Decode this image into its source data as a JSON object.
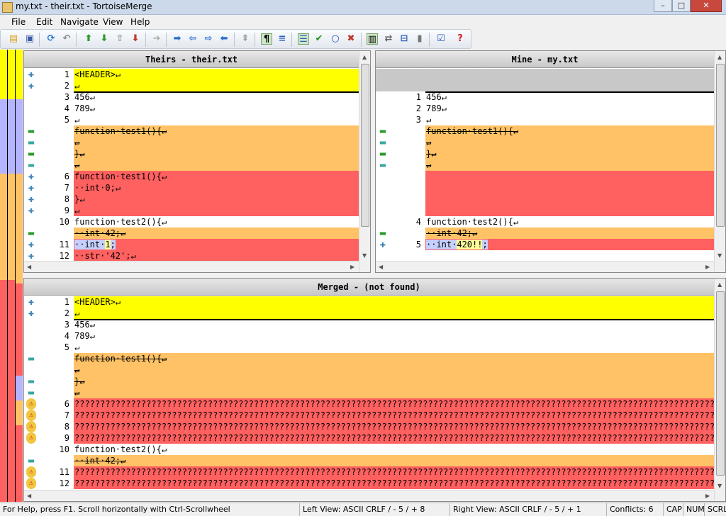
{
  "window": {
    "title": "my.txt - their.txt - TortoiseMerge",
    "min": "–",
    "max": "□",
    "close": "✕"
  },
  "menu": {
    "file": "File",
    "edit": "Edit",
    "navigate": "Navigate",
    "view": "View",
    "help": "Help"
  },
  "toolbar": {
    "icons": [
      "open-icon",
      "save-icon",
      "reload-icon",
      "undo-icon",
      "next-diff-icon",
      "prev-diff-icon",
      "prev-conflict-icon",
      "next-conflict-icon",
      "next-inline-icon",
      "first-diff-icon",
      "back-icon",
      "forward-icon",
      "last-diff-icon",
      "wrap-icon",
      "whitespace-icon",
      "inline-diff-icon",
      "line-diff-icon",
      "mark-resolved-icon",
      "use-both-icon",
      "discard-icon",
      "one-pane-icon",
      "switch-icon",
      "collapse-icon",
      "scroll-icon",
      "patch-icon",
      "help-icon"
    ]
  },
  "theirs": {
    "header": "Theirs - their.txt",
    "rows": [
      {
        "icon": "+",
        "num": "1",
        "text": "<HEADER>↵",
        "kind": "added"
      },
      {
        "icon": "+",
        "num": "2",
        "text": "↵",
        "kind": "added"
      },
      {
        "icon": "",
        "num": "3",
        "text": "456↵",
        "kind": "normal"
      },
      {
        "icon": "",
        "num": "4",
        "text": "789↵",
        "kind": "normal"
      },
      {
        "icon": "",
        "num": "5",
        "text": "↵",
        "kind": "normal"
      },
      {
        "icon": "=",
        "num": "",
        "text": "function·test1(){↵",
        "kind": "removed"
      },
      {
        "icon": "-",
        "num": "",
        "text": "↵",
        "kind": "removed"
      },
      {
        "icon": "=",
        "num": "",
        "text": "}↵",
        "kind": "removed"
      },
      {
        "icon": "-",
        "num": "",
        "text": "↵",
        "kind": "removed"
      },
      {
        "icon": "+",
        "num": "6",
        "text": "function·test1(){↵",
        "kind": "conflict"
      },
      {
        "icon": "+",
        "num": "7",
        "text": "··int·0;↵",
        "kind": "conflict"
      },
      {
        "icon": "+",
        "num": "8",
        "text": "}↵",
        "kind": "conflict"
      },
      {
        "icon": "+",
        "num": "9",
        "text": "↵",
        "kind": "conflict"
      },
      {
        "icon": "",
        "num": "10",
        "text": "function·test2(){↵",
        "kind": "normal"
      },
      {
        "icon": "=",
        "num": "",
        "text": "··int·42;↵",
        "kind": "removed"
      },
      {
        "icon": "+",
        "num": "11",
        "text": "··int·1;",
        "kind": "conflict",
        "hl": "int1"
      },
      {
        "icon": "+",
        "num": "12",
        "text": "··str·'42';↵",
        "kind": "conflict"
      }
    ]
  },
  "mine": {
    "header": "Mine - my.txt",
    "rows": [
      {
        "icon": "",
        "num": "",
        "text": "",
        "kind": "empty"
      },
      {
        "icon": "",
        "num": "",
        "text": "",
        "kind": "empty"
      },
      {
        "icon": "",
        "num": "1",
        "text": "456↵",
        "kind": "normal"
      },
      {
        "icon": "",
        "num": "2",
        "text": "789↵",
        "kind": "normal"
      },
      {
        "icon": "",
        "num": "3",
        "text": "↵",
        "kind": "normal"
      },
      {
        "icon": "=",
        "num": "",
        "text": "function·test1(){↵",
        "kind": "removed"
      },
      {
        "icon": "-",
        "num": "",
        "text": "↵",
        "kind": "removed"
      },
      {
        "icon": "=",
        "num": "",
        "text": "}↵",
        "kind": "removed"
      },
      {
        "icon": "-",
        "num": "",
        "text": "↵",
        "kind": "removed"
      },
      {
        "icon": "",
        "num": "",
        "text": "",
        "kind": "conflict"
      },
      {
        "icon": "",
        "num": "",
        "text": "",
        "kind": "conflict"
      },
      {
        "icon": "",
        "num": "",
        "text": "",
        "kind": "conflict"
      },
      {
        "icon": "",
        "num": "",
        "text": "",
        "kind": "conflict"
      },
      {
        "icon": "",
        "num": "4",
        "text": "function·test2(){↵",
        "kind": "normal"
      },
      {
        "icon": "=",
        "num": "",
        "text": "··int·42;↵",
        "kind": "removed"
      },
      {
        "icon": "+",
        "num": "5",
        "text": "··int·420!!;",
        "kind": "conflict",
        "hl": "int420"
      }
    ]
  },
  "merged": {
    "header": "Merged -  (not found)",
    "rows": [
      {
        "icon": "+",
        "num": "1",
        "text": "<HEADER>↵",
        "kind": "added"
      },
      {
        "icon": "+",
        "num": "2",
        "text": "↵",
        "kind": "added"
      },
      {
        "icon": "",
        "num": "3",
        "text": "456↵",
        "kind": "normal"
      },
      {
        "icon": "",
        "num": "4",
        "text": "789↵",
        "kind": "normal"
      },
      {
        "icon": "",
        "num": "5",
        "text": "↵",
        "kind": "normal"
      },
      {
        "icon": "-",
        "num": "",
        "text": "function·test1(){↵",
        "kind": "removed"
      },
      {
        "icon": "",
        "num": "",
        "text": "↵",
        "kind": "removed"
      },
      {
        "icon": "-",
        "num": "",
        "text": "}↵",
        "kind": "removed"
      },
      {
        "icon": "-",
        "num": "",
        "text": "↵",
        "kind": "removed"
      },
      {
        "icon": "!",
        "num": "6",
        "text": "????????????????????????????????????????????????????????????????????????????????????????????????????????????????????????????????",
        "kind": "conflict"
      },
      {
        "icon": "!",
        "num": "7",
        "text": "????????????????????????????????????????????????????????????????????????????????????????????????????????????????????????????????",
        "kind": "conflict"
      },
      {
        "icon": "!",
        "num": "8",
        "text": "????????????????????????????????????????????????????????????????????????????????????????????????????????????????????????????????",
        "kind": "conflict"
      },
      {
        "icon": "!",
        "num": "9",
        "text": "????????????????????????????????????????????????????????????????????????????????????????????????????????????????????????????????",
        "kind": "conflict"
      },
      {
        "icon": "",
        "num": "10",
        "text": "function·test2(){↵",
        "kind": "normal"
      },
      {
        "icon": "-",
        "num": "",
        "text": "··int·42;↵",
        "kind": "removed"
      },
      {
        "icon": "!",
        "num": "11",
        "text": "????????????????????????????????????????????????????????????????????????????????????????????????????????????????????????????????",
        "kind": "conflict"
      },
      {
        "icon": "!",
        "num": "12",
        "text": "????????????????????????????????????????????????????????????????????????????????????????????????????????????????????????????????",
        "kind": "conflict"
      }
    ]
  },
  "status": {
    "help": "For Help, press F1. Scroll horizontally with Ctrl-Scrollwheel",
    "left": "Left View: ASCII CRLF  / - 5 / + 8",
    "right": "Right View: ASCII CRLF  / - 5 / + 1",
    "conflicts": "Conflicts: 6",
    "cap": "CAP",
    "num": "NUM",
    "scrl": "SCRL"
  },
  "colors": {
    "added": "#ffff00",
    "removed": "#ffc266",
    "conflict": "#ff6060",
    "normal": "#ffffff",
    "empty": "#c8c8c8",
    "strip_blue": "#b4b4ff"
  }
}
